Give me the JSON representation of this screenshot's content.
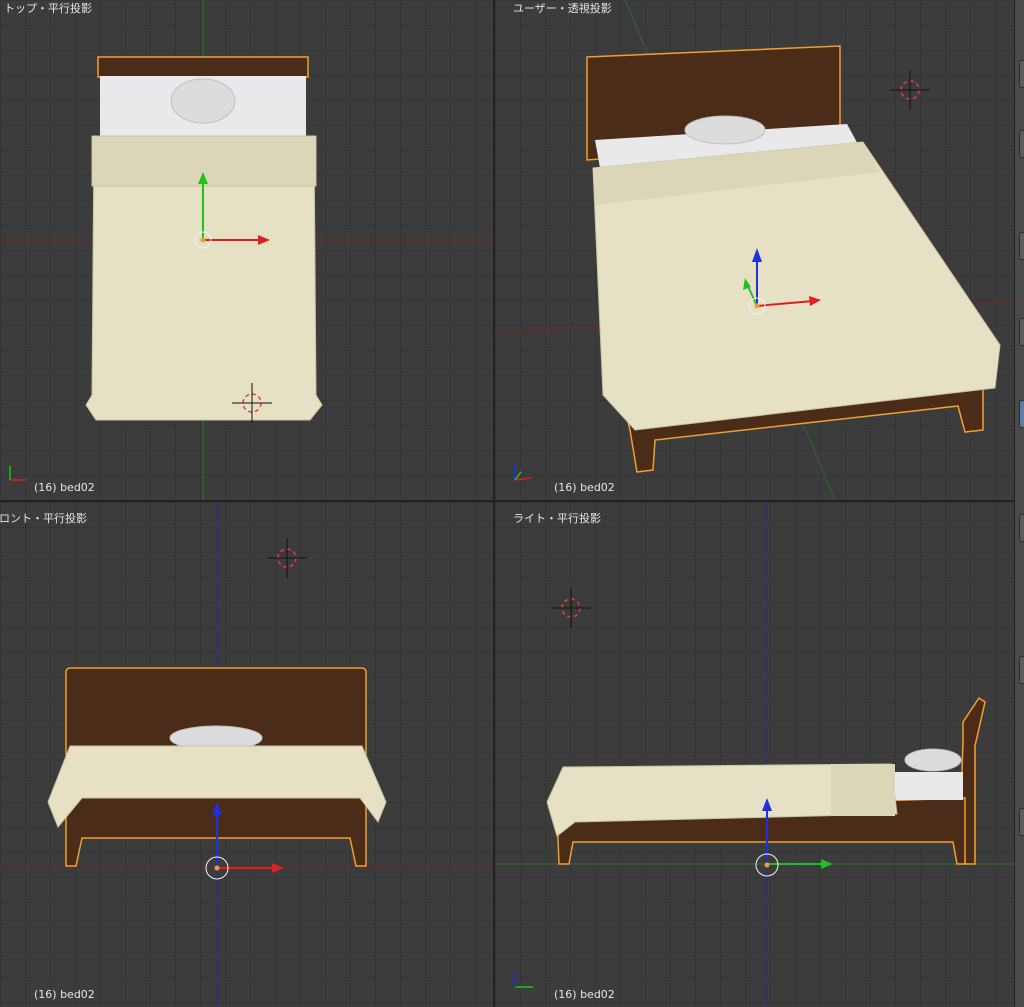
{
  "viewports": [
    {
      "id": "top",
      "title": "トップ・平行投影",
      "status": "(16) bed02"
    },
    {
      "id": "user",
      "title": "ユーザー・透視投影",
      "status": "(16) bed02"
    },
    {
      "id": "front",
      "title": "フロント・平行投影",
      "status": "(16) bed02"
    },
    {
      "id": "right",
      "title": "ライト・平行投影",
      "status": "(16) bed02"
    }
  ],
  "colors": {
    "background": "#3c3c3c",
    "wood": "#4a2c18",
    "wood_light": "#5c3a20",
    "outline": "#f0a030",
    "blanket": "#e6e0c4",
    "blanket_shadow": "#c9c2a0",
    "mattress": "#e9e9ec",
    "pillow": "#dcdcdc",
    "axis_x": "#e02020",
    "axis_y": "#20c020",
    "axis_z": "#2030e0"
  },
  "icons": {
    "cursor": "3d-cursor-icon",
    "origin": "object-origin-icon",
    "gizmo": "axis-gizmo-icon"
  }
}
